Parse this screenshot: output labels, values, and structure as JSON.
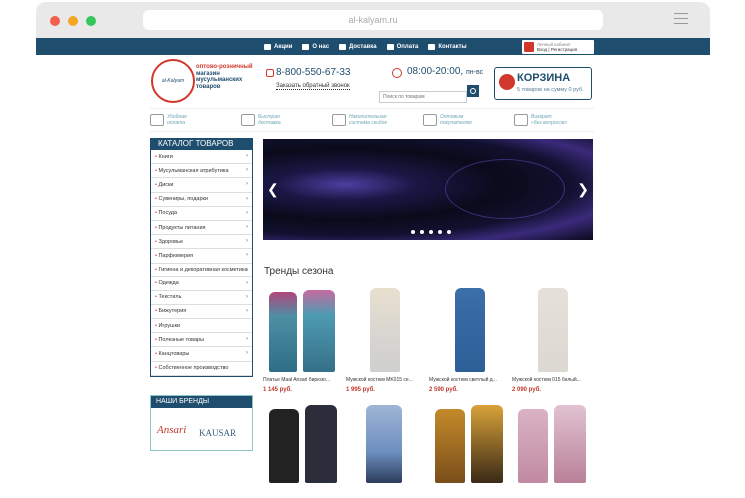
{
  "browser": {
    "url": "al-kalyam.ru"
  },
  "topnav": {
    "items": [
      {
        "label": "Акции",
        "icon": "percent-icon"
      },
      {
        "label": "О нас",
        "icon": "info-icon"
      },
      {
        "label": "Доставка",
        "icon": "truck-icon"
      },
      {
        "label": "Оплата",
        "icon": "wallet-icon"
      },
      {
        "label": "Контакты",
        "icon": "phone-icon"
      }
    ],
    "account_line1": "Личный кабинет",
    "account_line2": "Вход | Регистрация"
  },
  "header": {
    "logo_text": "al-Kalyam",
    "tagline_line1": "оптово-розничный",
    "tagline_line2": "магазин",
    "tagline_line3": "мусульманских",
    "tagline_line4": "товаров",
    "phone": "8-800-550-67-33",
    "callback": "Заказать обратный звонок",
    "hours": "08:00-20:00,",
    "hours_days": "пн-вс",
    "search_placeholder": "Поиск по товарам",
    "cart_title": "КОРЗИНА",
    "cart_summary": "5 товаров на сумму 0 руб."
  },
  "features": [
    {
      "line1": "Удобная",
      "line2": "оплата"
    },
    {
      "line1": "Быстрая",
      "line2": "доставка"
    },
    {
      "line1": "Накопительная",
      "line2": "система скидок"
    },
    {
      "line1": "Оптовым",
      "line2": "покупателям"
    },
    {
      "line1": "Возврат",
      "line2": "«без вопросов»"
    }
  ],
  "catalog": {
    "title": "КАТАЛОГ ТОВАРОВ",
    "items": [
      "Книги",
      "Мусульманская атрибутика",
      "Диски",
      "Сувениры, подарки",
      "Посуда",
      "Продукты питания",
      "Здоровье",
      "Парфюмерия",
      "Гигиена и декоративная косметика",
      "Одежда",
      "Текстиль",
      "Бижутерия",
      "Игрушки",
      "Полезные товары",
      "Канцтовары",
      "Собственное производство"
    ]
  },
  "brands": {
    "title": "НАШИ БРЕНДЫ",
    "items": [
      "Ansari",
      "KAUSAR"
    ]
  },
  "trends": {
    "title": "Тренды сезона",
    "products": [
      {
        "name": "Платье Maal Ansari бирюзо...",
        "price": "1 145 руб."
      },
      {
        "name": "Мужской костюм MK015 се...",
        "price": "1 995 руб."
      },
      {
        "name": "Мужской костюм светлый д...",
        "price": "2 590 руб."
      },
      {
        "name": "Мужской костюм 015 белый...",
        "price": "2 090 руб."
      }
    ]
  }
}
